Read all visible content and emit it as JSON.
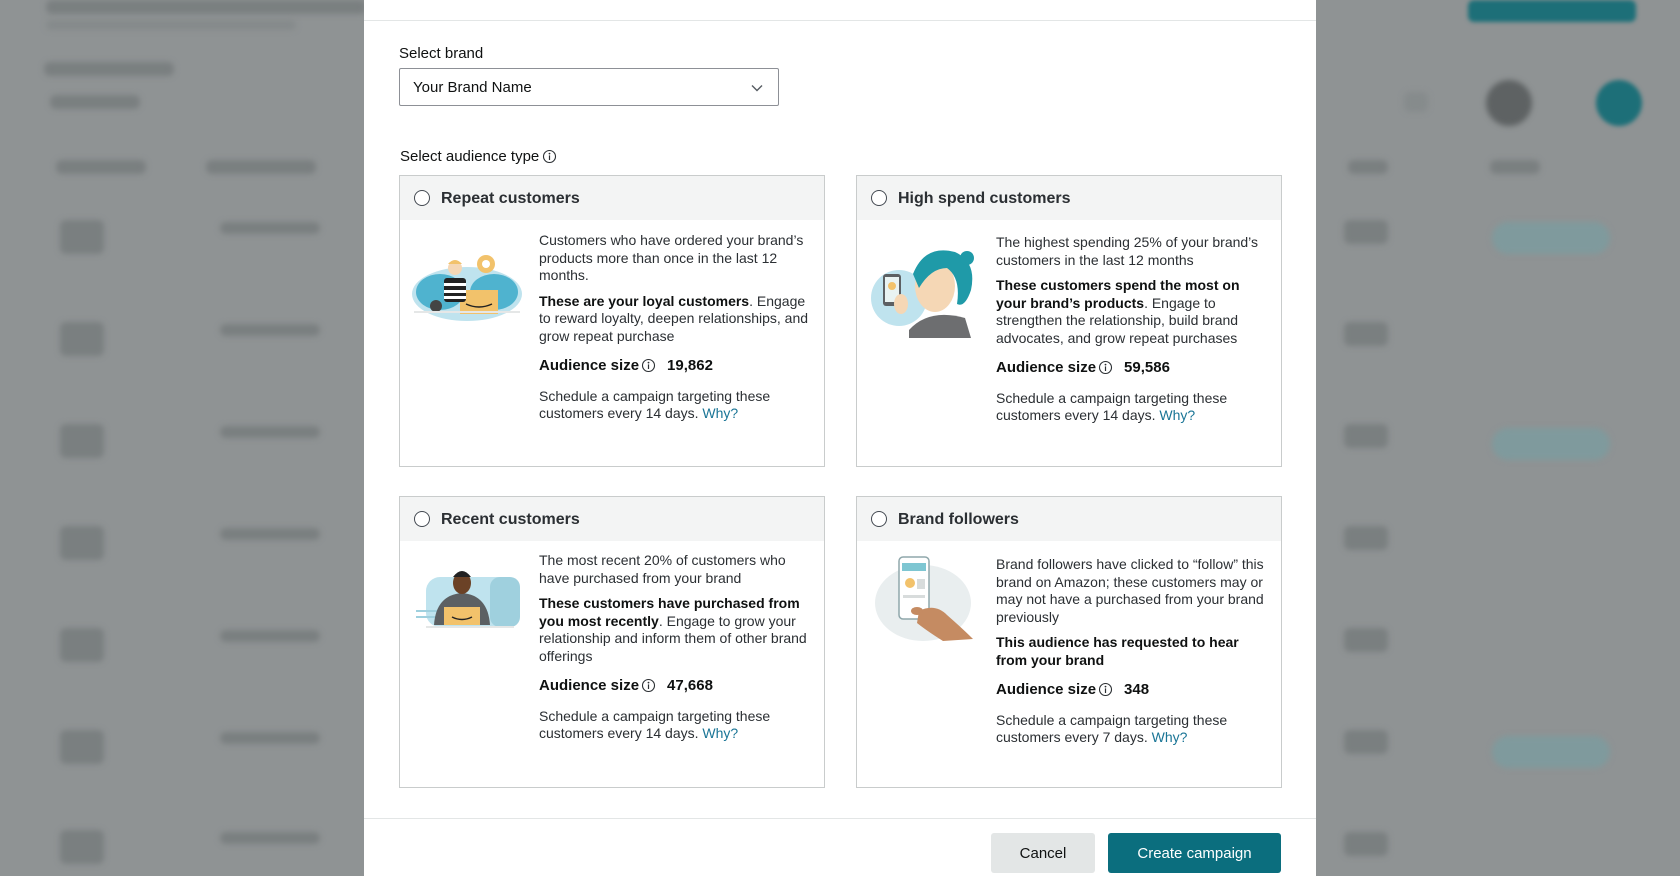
{
  "brand_select": {
    "label": "Select brand",
    "value": "Your Brand Name"
  },
  "audience": {
    "label": "Select audience type",
    "cards": [
      {
        "title": "Repeat customers",
        "description": "Customers who have ordered your brand’s products more than once in the last 12 months.",
        "strong_text": "These are your loyal customers",
        "rest_text": ". Engage to reward loyalty, deepen relationships, and grow repeat purchase",
        "size_label": "Audience size",
        "size_value": "19,862",
        "schedule_text": "Schedule a campaign targeting these customers every 14 days.",
        "why_label": "Why?"
      },
      {
        "title": "High spend customers",
        "description": "The highest spending 25% of your brand’s customers in the last 12 months",
        "strong_text": "These customers spend the most on your brand’s products",
        "rest_text": ". Engage to strengthen the relationship, build brand advocates, and grow repeat purchases",
        "size_label": "Audience size",
        "size_value": "59,586",
        "schedule_text": "Schedule a campaign targeting these customers every 14 days.",
        "why_label": "Why?"
      },
      {
        "title": "Recent customers",
        "description": "The most recent 20% of customers who have purchased from your brand",
        "strong_text": "These customers have purchased from you most recently",
        "rest_text": ". Engage to grow your relationship and inform them of other brand offerings",
        "size_label": "Audience size",
        "size_value": "47,668",
        "schedule_text": "Schedule a campaign targeting these customers every 14 days.",
        "why_label": "Why?"
      },
      {
        "title": "Brand followers",
        "description": "Brand followers have clicked to “follow” this brand on Amazon; these customers may or may not have a purchased from your brand previously",
        "strong_text": "This audience has requested to hear from your brand",
        "rest_text": "",
        "size_label": "Audience size",
        "size_value": "348",
        "schedule_text": "Schedule a campaign targeting these customers every 7 days.",
        "why_label": "Why?"
      }
    ]
  },
  "footer": {
    "cancel_label": "Cancel",
    "create_label": "Create campaign"
  },
  "colors": {
    "primary_button": "#0b6e7e",
    "link": "#1a7596",
    "card_header": "#f3f4f4"
  }
}
